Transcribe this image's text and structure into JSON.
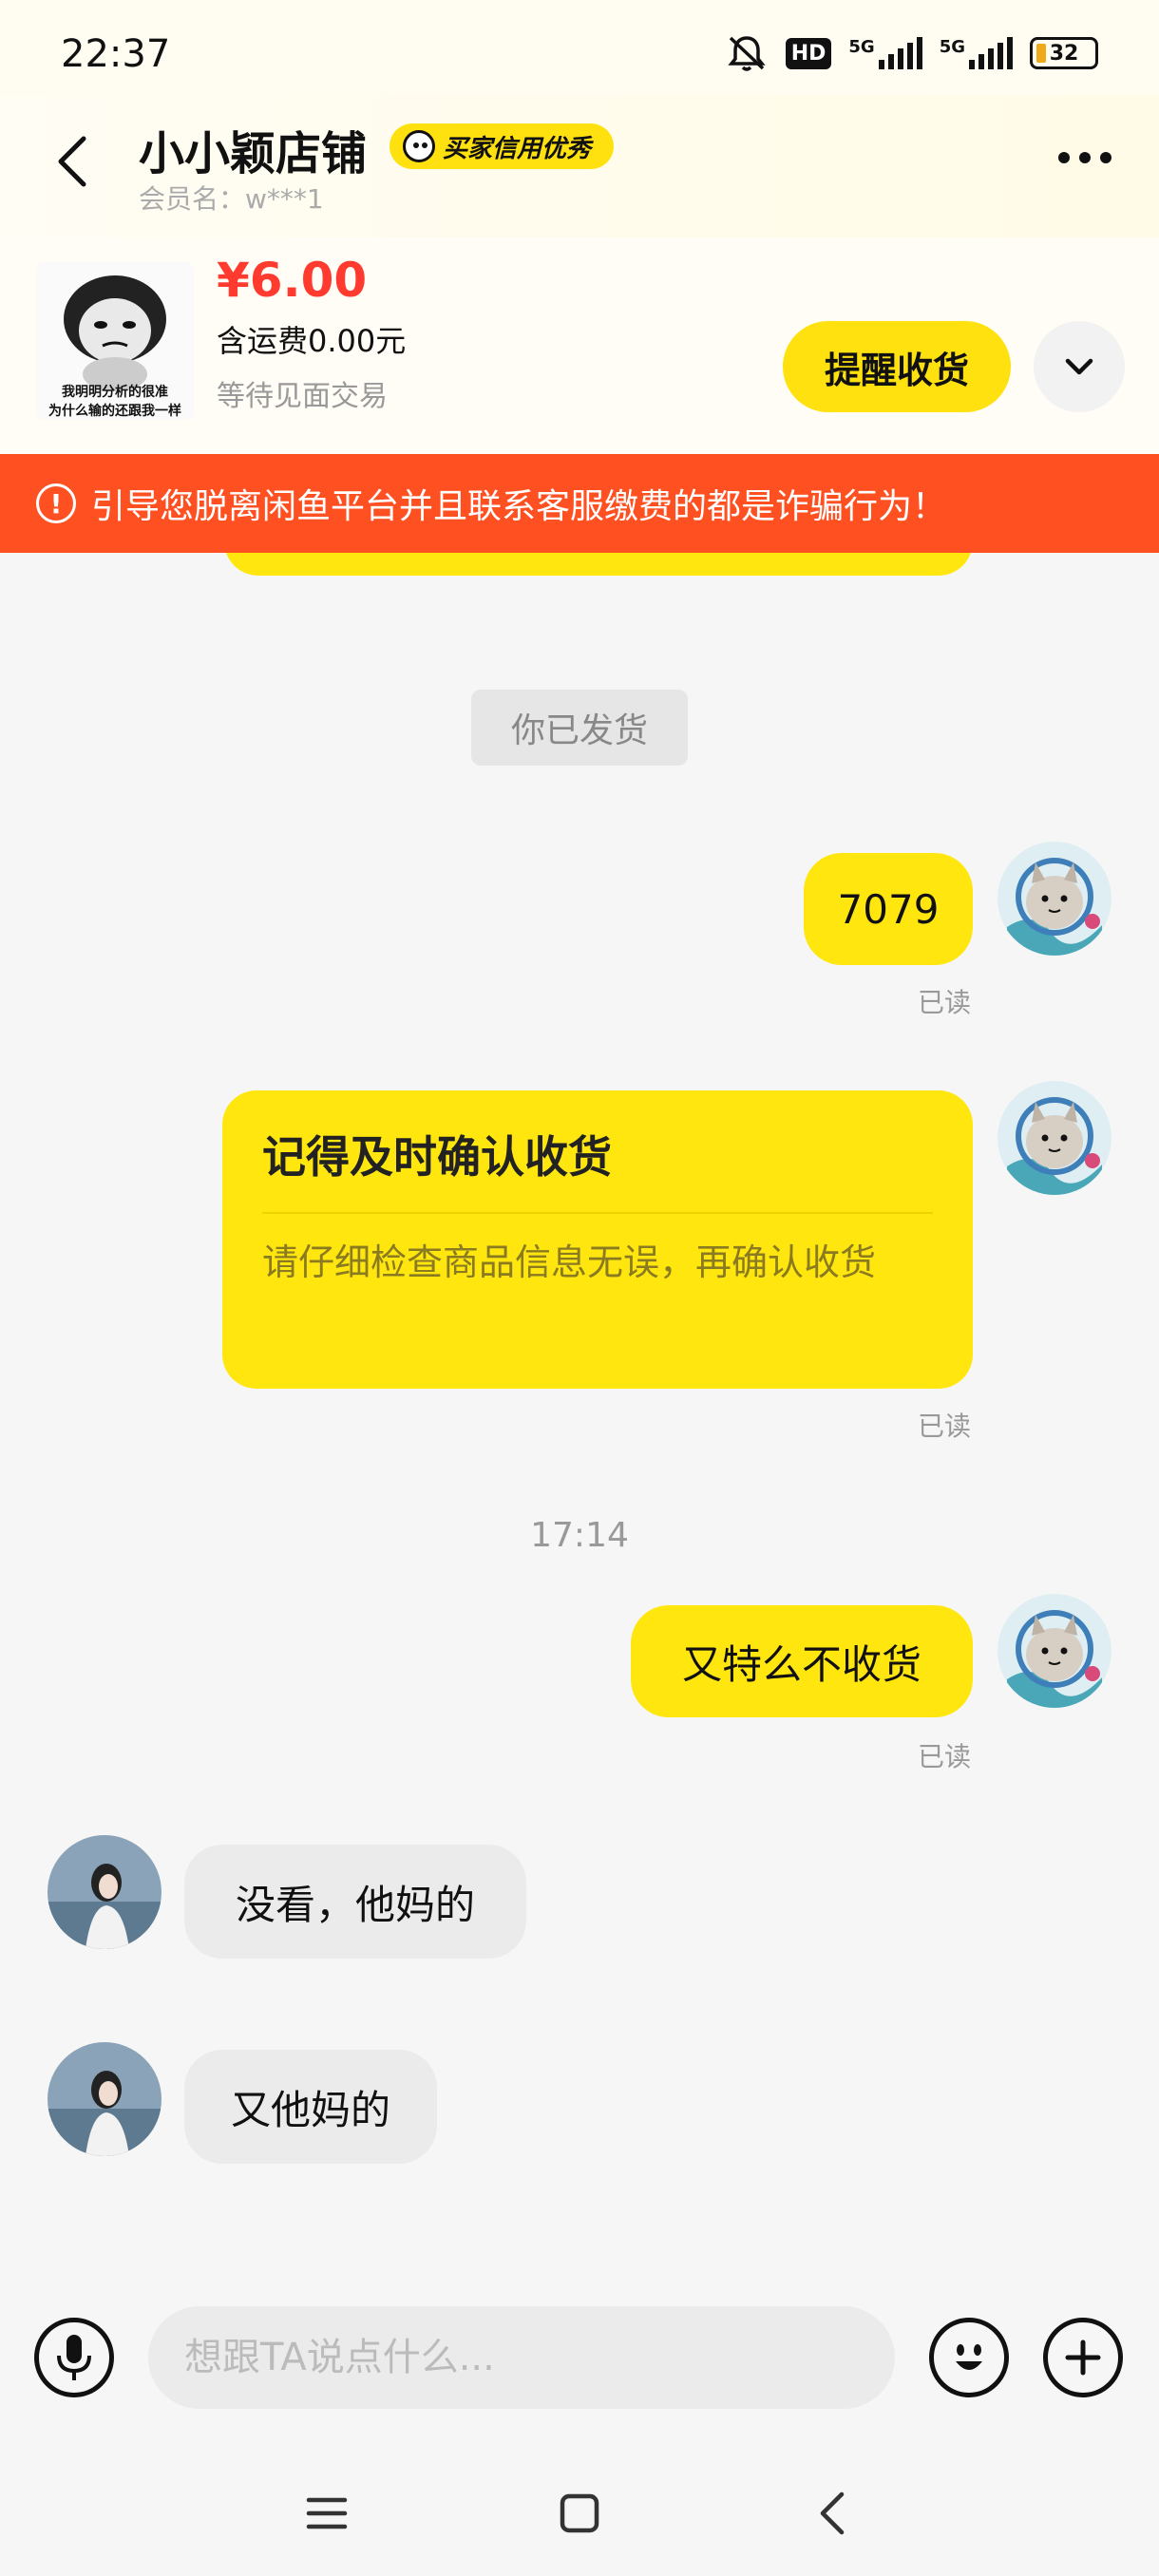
{
  "status_bar": {
    "time": "22:37",
    "hd_label": "HD",
    "net1": "5G",
    "net2": "5G",
    "battery": "32",
    "icons": [
      "mute-icon",
      "signal-icon",
      "battery-icon"
    ]
  },
  "header": {
    "shop_name": "小小颖店铺",
    "badge": "买家信用优秀",
    "member": "会员名：w***1",
    "more_icon": "more-icon",
    "back_icon": "back-arrow-icon"
  },
  "product": {
    "thumb_caption1": "我明明分析的很准",
    "thumb_caption2": "为什么输的还跟我一样",
    "price": "¥6.00",
    "shipping": "含运费0.00元",
    "status": "等待见面交易",
    "remind_button": "提醒收货",
    "expand_icon": "chevron-down-icon"
  },
  "warning": {
    "text": "引导您脱离闲鱼平台并且联系客服缴费的都是诈骗行为！"
  },
  "chat": {
    "system_chip": "你已发货",
    "msg1": {
      "text": "7079",
      "read": "已读"
    },
    "card": {
      "title": "记得及时确认收货",
      "body": "请仔细检查商品信息无误，再确认收货",
      "read": "已读"
    },
    "time": "17:14",
    "msg2": {
      "text": "又特么不收货",
      "read": "已读"
    },
    "other1": {
      "text": "没看，他妈的"
    },
    "other2": {
      "text": "又他妈的"
    }
  },
  "input": {
    "placeholder": "想跟TA说点什么...",
    "voice_icon": "microphone-icon",
    "emoji_icon": "emoji-icon",
    "plus_icon": "plus-icon"
  },
  "colors": {
    "accent": "#ffe60f",
    "warning": "#ff5022",
    "price": "#ff3b30"
  }
}
